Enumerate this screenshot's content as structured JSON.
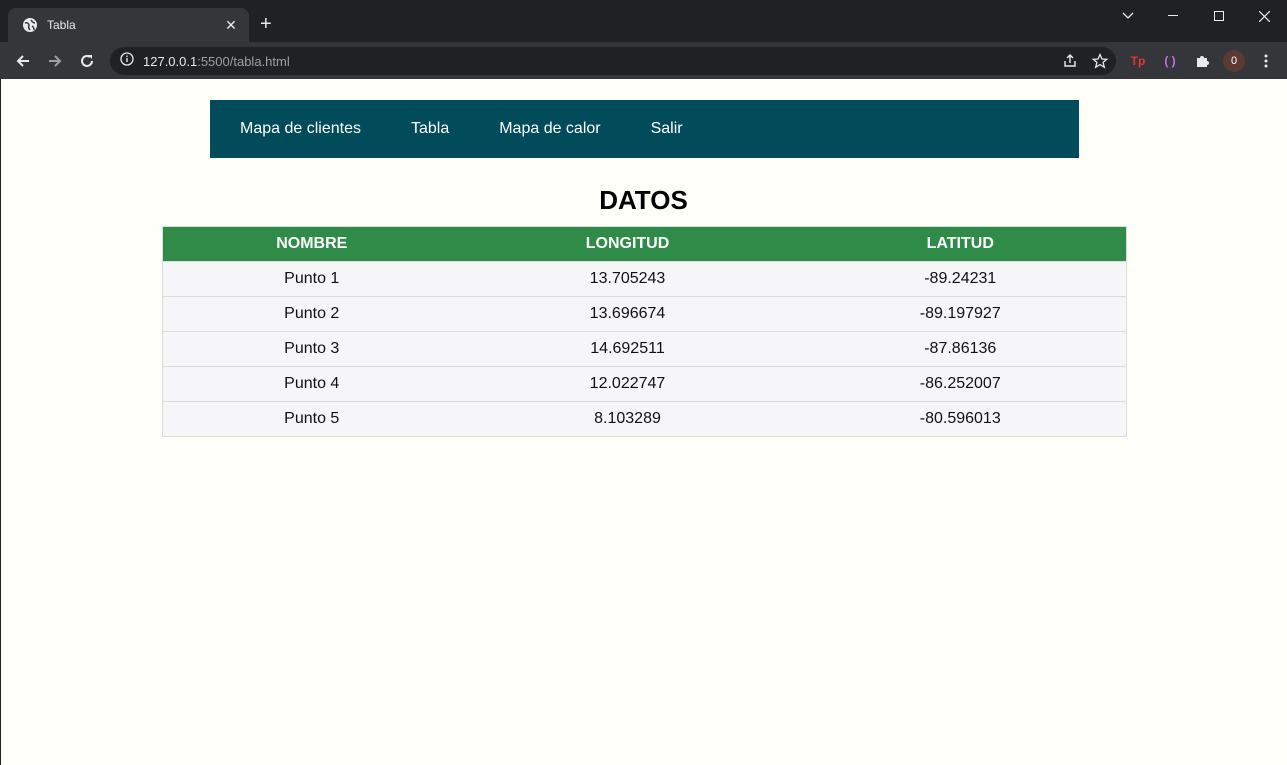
{
  "browser": {
    "tab_title": "Tabla",
    "url_host": "127.0.0.1",
    "url_rest": ":5500/tabla.html",
    "profile_initial": "0",
    "ext1_label": "Tp",
    "ext2_label": "( )"
  },
  "nav": {
    "items": [
      "Mapa de clientes",
      "Tabla",
      "Mapa de calor",
      "Salir"
    ]
  },
  "page": {
    "title": "DATOS"
  },
  "table": {
    "headers": [
      "NOMBRE",
      "LONGITUD",
      "LATITUD"
    ],
    "rows": [
      [
        "Punto 1",
        "13.705243",
        "-89.24231"
      ],
      [
        "Punto 2",
        "13.696674",
        "-89.197927"
      ],
      [
        "Punto 3",
        "14.692511",
        "-87.86136"
      ],
      [
        "Punto 4",
        "12.022747",
        "-86.252007"
      ],
      [
        "Punto 5",
        "8.103289",
        "-80.596013"
      ]
    ]
  },
  "colors": {
    "navbar": "#014b5a",
    "table_header": "#2e8b48",
    "page_background": "#fefff9"
  }
}
